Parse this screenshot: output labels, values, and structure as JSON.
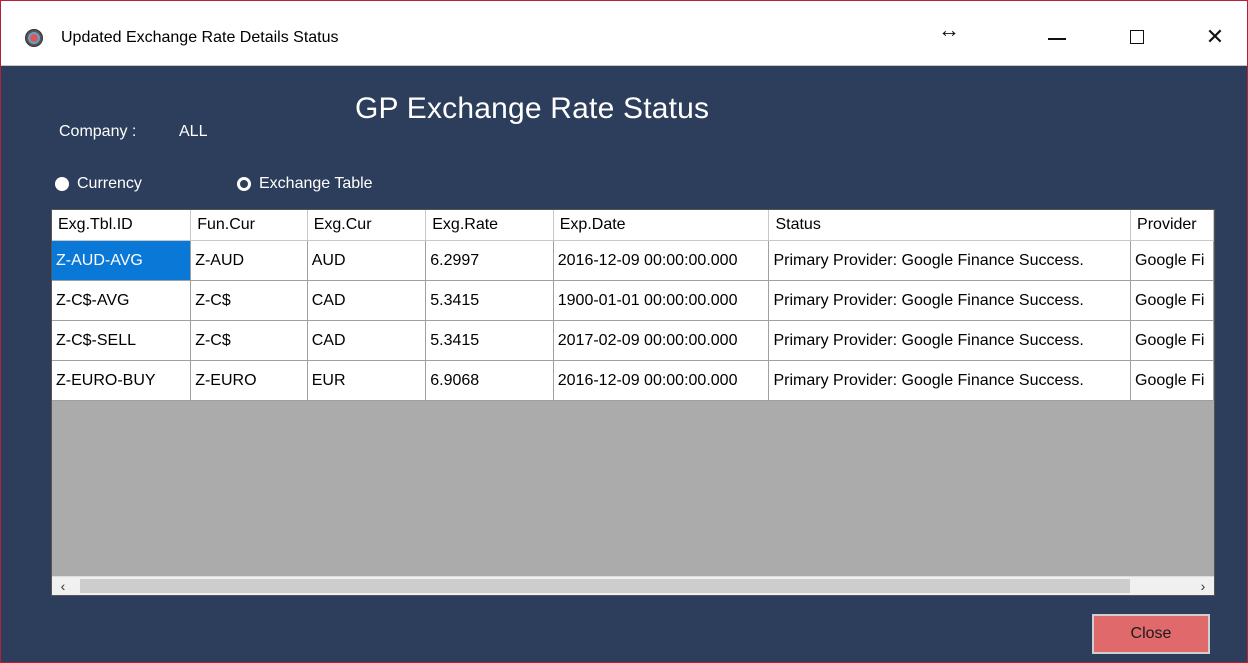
{
  "window": {
    "title": "Updated Exchange Rate Details Status",
    "controls": {
      "resize": "↔",
      "minimize": "",
      "maximize": "",
      "close": "✕"
    }
  },
  "header": {
    "title": "GP Exchange Rate Status",
    "company_label": "Company :",
    "company_value": "ALL"
  },
  "view_options": [
    {
      "label": "Currency",
      "selected": true
    },
    {
      "label": "Exchange Table",
      "selected": false
    }
  ],
  "grid": {
    "columns": [
      "Exg.Tbl.ID",
      "Fun.Cur",
      "Exg.Cur",
      "Exg.Rate",
      "Exp.Date",
      "Status",
      "Provider"
    ],
    "rows": [
      [
        "Z-AUD-AVG",
        "Z-AUD",
        "AUD",
        "6.2997",
        "2016-12-09 00:00:00.000",
        "Primary Provider: Google Finance Success.",
        "Google Fi"
      ],
      [
        "Z-C$-AVG",
        "Z-C$",
        "CAD",
        "5.3415",
        "1900-01-01 00:00:00.000",
        "Primary Provider: Google Finance Success.",
        "Google Fi"
      ],
      [
        "Z-C$-SELL",
        "Z-C$",
        "CAD",
        "5.3415",
        "2017-02-09 00:00:00.000",
        "Primary Provider: Google Finance Success.",
        "Google Fi"
      ],
      [
        "Z-EURO-BUY",
        "Z-EURO",
        "EUR",
        "6.9068",
        "2016-12-09 00:00:00.000",
        "Primary Provider: Google Finance Success.",
        "Google Fi"
      ]
    ],
    "scroll_left": "‹",
    "scroll_right": "›"
  },
  "actions": {
    "close_label": "Close"
  },
  "colors": {
    "background": "#2c3e5b",
    "selected_cell": "#0a78d7",
    "close_button": "#e0696b"
  }
}
